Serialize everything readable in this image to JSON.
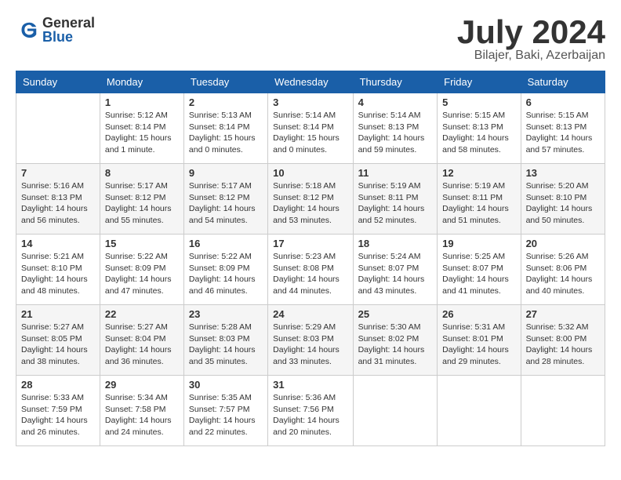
{
  "header": {
    "logo_general": "General",
    "logo_blue": "Blue",
    "month_title": "July 2024",
    "location": "Bilajer, Baki, Azerbaijan"
  },
  "calendar": {
    "days_of_week": [
      "Sunday",
      "Monday",
      "Tuesday",
      "Wednesday",
      "Thursday",
      "Friday",
      "Saturday"
    ],
    "weeks": [
      [
        {
          "day": "",
          "info": ""
        },
        {
          "day": "1",
          "info": "Sunrise: 5:12 AM\nSunset: 8:14 PM\nDaylight: 15 hours\nand 1 minute."
        },
        {
          "day": "2",
          "info": "Sunrise: 5:13 AM\nSunset: 8:14 PM\nDaylight: 15 hours\nand 0 minutes."
        },
        {
          "day": "3",
          "info": "Sunrise: 5:14 AM\nSunset: 8:14 PM\nDaylight: 15 hours\nand 0 minutes."
        },
        {
          "day": "4",
          "info": "Sunrise: 5:14 AM\nSunset: 8:13 PM\nDaylight: 14 hours\nand 59 minutes."
        },
        {
          "day": "5",
          "info": "Sunrise: 5:15 AM\nSunset: 8:13 PM\nDaylight: 14 hours\nand 58 minutes."
        },
        {
          "day": "6",
          "info": "Sunrise: 5:15 AM\nSunset: 8:13 PM\nDaylight: 14 hours\nand 57 minutes."
        }
      ],
      [
        {
          "day": "7",
          "info": "Sunrise: 5:16 AM\nSunset: 8:13 PM\nDaylight: 14 hours\nand 56 minutes."
        },
        {
          "day": "8",
          "info": "Sunrise: 5:17 AM\nSunset: 8:12 PM\nDaylight: 14 hours\nand 55 minutes."
        },
        {
          "day": "9",
          "info": "Sunrise: 5:17 AM\nSunset: 8:12 PM\nDaylight: 14 hours\nand 54 minutes."
        },
        {
          "day": "10",
          "info": "Sunrise: 5:18 AM\nSunset: 8:12 PM\nDaylight: 14 hours\nand 53 minutes."
        },
        {
          "day": "11",
          "info": "Sunrise: 5:19 AM\nSunset: 8:11 PM\nDaylight: 14 hours\nand 52 minutes."
        },
        {
          "day": "12",
          "info": "Sunrise: 5:19 AM\nSunset: 8:11 PM\nDaylight: 14 hours\nand 51 minutes."
        },
        {
          "day": "13",
          "info": "Sunrise: 5:20 AM\nSunset: 8:10 PM\nDaylight: 14 hours\nand 50 minutes."
        }
      ],
      [
        {
          "day": "14",
          "info": "Sunrise: 5:21 AM\nSunset: 8:10 PM\nDaylight: 14 hours\nand 48 minutes."
        },
        {
          "day": "15",
          "info": "Sunrise: 5:22 AM\nSunset: 8:09 PM\nDaylight: 14 hours\nand 47 minutes."
        },
        {
          "day": "16",
          "info": "Sunrise: 5:22 AM\nSunset: 8:09 PM\nDaylight: 14 hours\nand 46 minutes."
        },
        {
          "day": "17",
          "info": "Sunrise: 5:23 AM\nSunset: 8:08 PM\nDaylight: 14 hours\nand 44 minutes."
        },
        {
          "day": "18",
          "info": "Sunrise: 5:24 AM\nSunset: 8:07 PM\nDaylight: 14 hours\nand 43 minutes."
        },
        {
          "day": "19",
          "info": "Sunrise: 5:25 AM\nSunset: 8:07 PM\nDaylight: 14 hours\nand 41 minutes."
        },
        {
          "day": "20",
          "info": "Sunrise: 5:26 AM\nSunset: 8:06 PM\nDaylight: 14 hours\nand 40 minutes."
        }
      ],
      [
        {
          "day": "21",
          "info": "Sunrise: 5:27 AM\nSunset: 8:05 PM\nDaylight: 14 hours\nand 38 minutes."
        },
        {
          "day": "22",
          "info": "Sunrise: 5:27 AM\nSunset: 8:04 PM\nDaylight: 14 hours\nand 36 minutes."
        },
        {
          "day": "23",
          "info": "Sunrise: 5:28 AM\nSunset: 8:03 PM\nDaylight: 14 hours\nand 35 minutes."
        },
        {
          "day": "24",
          "info": "Sunrise: 5:29 AM\nSunset: 8:03 PM\nDaylight: 14 hours\nand 33 minutes."
        },
        {
          "day": "25",
          "info": "Sunrise: 5:30 AM\nSunset: 8:02 PM\nDaylight: 14 hours\nand 31 minutes."
        },
        {
          "day": "26",
          "info": "Sunrise: 5:31 AM\nSunset: 8:01 PM\nDaylight: 14 hours\nand 29 minutes."
        },
        {
          "day": "27",
          "info": "Sunrise: 5:32 AM\nSunset: 8:00 PM\nDaylight: 14 hours\nand 28 minutes."
        }
      ],
      [
        {
          "day": "28",
          "info": "Sunrise: 5:33 AM\nSunset: 7:59 PM\nDaylight: 14 hours\nand 26 minutes."
        },
        {
          "day": "29",
          "info": "Sunrise: 5:34 AM\nSunset: 7:58 PM\nDaylight: 14 hours\nand 24 minutes."
        },
        {
          "day": "30",
          "info": "Sunrise: 5:35 AM\nSunset: 7:57 PM\nDaylight: 14 hours\nand 22 minutes."
        },
        {
          "day": "31",
          "info": "Sunrise: 5:36 AM\nSunset: 7:56 PM\nDaylight: 14 hours\nand 20 minutes."
        },
        {
          "day": "",
          "info": ""
        },
        {
          "day": "",
          "info": ""
        },
        {
          "day": "",
          "info": ""
        }
      ]
    ]
  }
}
